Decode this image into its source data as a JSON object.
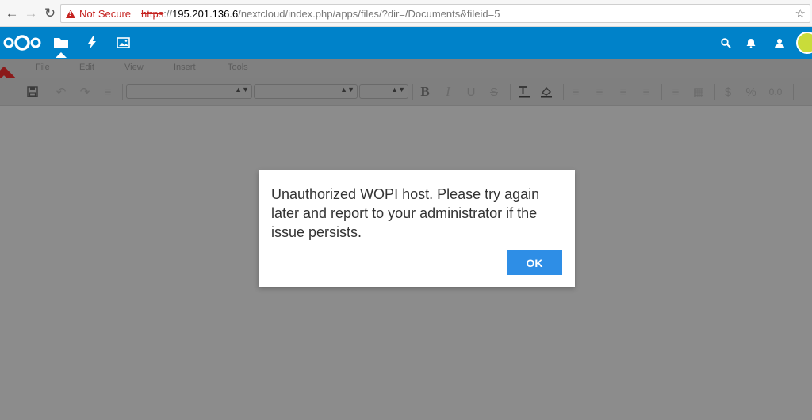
{
  "browser": {
    "security_label": "Not Secure",
    "url_scheme": "https",
    "url_sep": "://",
    "url_host": "195.201.136.6",
    "url_path": "/nextcloud/index.php/apps/files/?dir=/Documents&fileid=5"
  },
  "header": {
    "accent_color": "#0082c9",
    "apps": [
      "files-icon",
      "activity-icon",
      "gallery-icon"
    ],
    "right_icons": [
      "search-icon",
      "notifications-icon",
      "contacts-icon",
      "avatar"
    ]
  },
  "editor": {
    "menu": [
      "File",
      "Edit",
      "View",
      "Insert",
      "Tools"
    ]
  },
  "dialog": {
    "message": "Unauthorized WOPI host. Please try again later and report to your administrator if the issue persists.",
    "ok_label": "OK",
    "button_color": "#2e8ee6"
  }
}
